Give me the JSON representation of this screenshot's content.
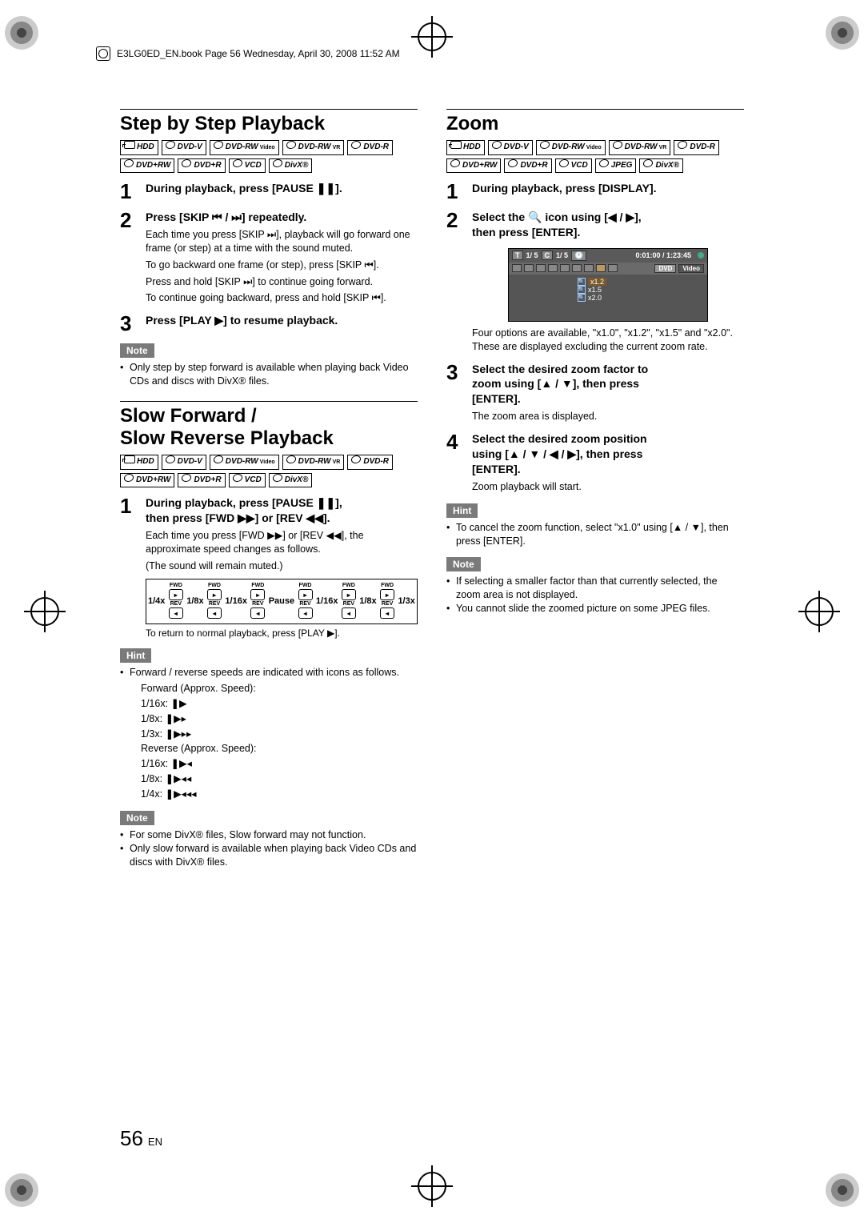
{
  "meta": {
    "header_line": "E3LG0ED_EN.book  Page 56  Wednesday, April 30, 2008  11:52 AM"
  },
  "col_left": {
    "section1": {
      "title": "Step by Step Playback",
      "formats": [
        "HDD",
        "DVD-V",
        "DVD-RW Video",
        "DVD-RW VR",
        "DVD-R",
        "DVD+RW",
        "DVD+R",
        "VCD",
        "DivX®"
      ],
      "step1": {
        "num": "1",
        "head": "During playback, press [PAUSE ❚❚]."
      },
      "step2": {
        "num": "2",
        "head": "Press [SKIP ⏮ / ⏭] repeatedly.",
        "p1": "Each time you press [SKIP ⏭], playback will go forward one frame (or step) at a time with the sound muted.",
        "p2": "To go backward one frame (or step), press [SKIP ⏮].",
        "p3": "Press and hold [SKIP ⏭] to continue going forward.",
        "p4": "To continue going backward, press and hold [SKIP ⏮]."
      },
      "step3": {
        "num": "3",
        "head": "Press [PLAY ▶] to resume playback."
      },
      "note_label": "Note",
      "notes": [
        "Only step by step forward is available when playing back Video CDs and discs with DivX® files."
      ]
    },
    "section2": {
      "title_l1": "Slow Forward /",
      "title_l2": "Slow Reverse Playback",
      "formats": [
        "HDD",
        "DVD-V",
        "DVD-RW Video",
        "DVD-RW VR",
        "DVD-R",
        "DVD+RW",
        "DVD+R",
        "VCD",
        "DivX®"
      ],
      "step1": {
        "num": "1",
        "head_l1": "During playback, press [PAUSE ❚❚],",
        "head_l2": "then press [FWD ▶▶] or [REV ◀◀].",
        "p1": "Each time you press [FWD ▶▶] or [REV ◀◀], the approximate speed changes as follows.",
        "p2": "(The sound will remain muted.)"
      },
      "diagram": {
        "labels": [
          "1/4x",
          "1/8x",
          "1/16x",
          "Pause",
          "1/16x",
          "1/8x",
          "1/3x"
        ],
        "sub": "To return to normal playback, press [PLAY ▶]."
      },
      "hint_label": "Hint",
      "hint_intro": "Forward / reverse speeds are indicated with icons as follows.",
      "speeds": {
        "fwd_title": "Forward (Approx. Speed):",
        "fwd": [
          {
            "rate": "1/16x:",
            "icon": "❚▶"
          },
          {
            "rate": "1/8x:",
            "icon": "❚▶▸"
          },
          {
            "rate": "1/3x:",
            "icon": "❚▶▸▸"
          }
        ],
        "rev_title": "Reverse (Approx. Speed):",
        "rev": [
          {
            "rate": "1/16x:",
            "icon": "❚▶◂"
          },
          {
            "rate": "1/8x:",
            "icon": "❚▶◂◂"
          },
          {
            "rate": "1/4x:",
            "icon": "❚▶◂◂◂"
          }
        ]
      },
      "note_label": "Note",
      "notes": [
        "For some DivX® files, Slow forward may not function.",
        "Only slow forward is available when playing back Video CDs and discs with DivX® files."
      ]
    }
  },
  "col_right": {
    "section1": {
      "title": "Zoom",
      "formats": [
        "HDD",
        "DVD-V",
        "DVD-RW Video",
        "DVD-RW VR",
        "DVD-R",
        "DVD+RW",
        "DVD+R",
        "VCD",
        "JPEG",
        "DivX®"
      ],
      "step1": {
        "num": "1",
        "head": "During playback, press [DISPLAY]."
      },
      "step2": {
        "num": "2",
        "head_l1": "Select the 🔍 icon using [◀ / ▶],",
        "head_l2": "then press [ENTER].",
        "osd": {
          "bar1": {
            "t": "T",
            "tval": "1/  5",
            "c": "C",
            "cval": "1/  5",
            "clock": "🕐",
            "time": "0:01:00 / 1:23:45"
          },
          "badges": [
            "DVD",
            "Video"
          ],
          "zoom_options": [
            "x1.2",
            "x1.5",
            "x2.0"
          ]
        },
        "p1": "Four options are available, \"x1.0\", \"x1.2\", \"x1.5\" and \"x2.0\". These are displayed excluding the current zoom rate."
      },
      "step3": {
        "num": "3",
        "head_l1": "Select the desired zoom factor to",
        "head_l2": "zoom using [▲ / ▼], then press",
        "head_l3": "[ENTER].",
        "p1": "The zoom area is displayed."
      },
      "step4": {
        "num": "4",
        "head_l1": "Select the desired zoom position",
        "head_l2": "using [▲ / ▼ / ◀ / ▶], then press",
        "head_l3": "[ENTER].",
        "p1": "Zoom playback will start."
      },
      "hint_label": "Hint",
      "hints": [
        "To cancel the zoom function, select \"x1.0\" using [▲ / ▼], then press [ENTER]."
      ],
      "note_label": "Note",
      "notes": [
        "If selecting a smaller factor than that currently selected, the zoom area is not displayed.",
        "You cannot slide the zoomed picture on some JPEG files."
      ]
    }
  },
  "footer": {
    "page": "56",
    "lang": "EN"
  }
}
